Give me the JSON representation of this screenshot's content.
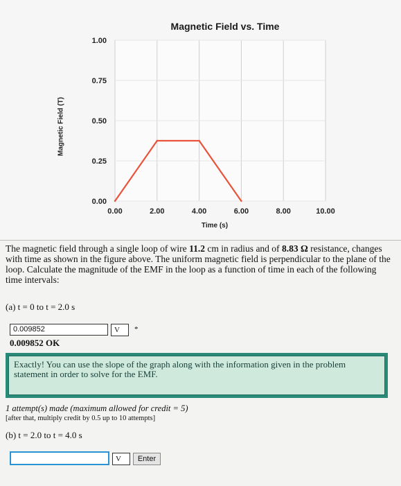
{
  "chart_data": {
    "type": "line",
    "title": "Magnetic Field vs. Time",
    "xlabel": "Time (s)",
    "ylabel": "Magnetic Field (T)",
    "x_ticks": [
      "0.00",
      "2.00",
      "4.00",
      "6.00",
      "8.00",
      "10.00"
    ],
    "y_ticks": [
      "0.00",
      "0.25",
      "0.50",
      "0.75",
      "1.00"
    ],
    "xlim": [
      0,
      10
    ],
    "ylim": [
      0,
      1
    ],
    "grid": true,
    "series": [
      {
        "color": "#e8533a",
        "x": [
          0,
          2,
          4,
          6
        ],
        "y": [
          0,
          0.375,
          0.375,
          0
        ]
      }
    ]
  },
  "problem": {
    "text_1": "The magnetic field through a single loop of wire ",
    "radius": "11.2",
    "text_2": " cm in radius and of ",
    "resistance": "8.83 Ω",
    "text_3": " resistance, changes with time as shown in the figure above. The uniform magnetic field is perpendicular to the plane of the loop. Calculate the magnitude of the EMF in the loop as a function of time in each of the following time intervals:"
  },
  "part_a": {
    "label": "(a) t = 0 to t = 2.0 s",
    "input_value": "0.009852",
    "v_label": "V",
    "star": "*",
    "ok_text": "0.009852  OK"
  },
  "feedback": "Exactly! You can use the slope of the graph along with the information given in the problem statement in order to solve for the EMF.",
  "attempts": {
    "text": "1 attempt(s) made (maximum allowed for credit = 5)",
    "note": "[after that, multiply credit by 0.5 up to 10 attempts]"
  },
  "part_b": {
    "label": "(b) t = 2.0 to t = 4.0 s",
    "input_value": "",
    "v_label": "V",
    "enter_label": "Enter"
  }
}
